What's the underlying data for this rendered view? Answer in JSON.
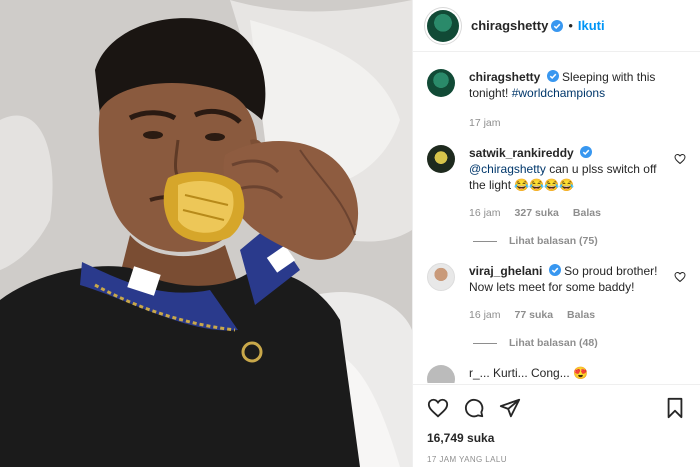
{
  "post": {
    "username": "chiragshetty",
    "follow_label": "Ikuti",
    "caption_text": "Sleeping with this tonight!",
    "caption_hashtag": "#worldchampions",
    "caption_time": "17 jam",
    "likes": "16,749 suka",
    "posted_ago": "17 JAM YANG LALU"
  },
  "comments": [
    {
      "username": "satwik_rankireddy",
      "mention": "@chiragshetty",
      "text": "can u plss switch off the light 😂😂😂😂",
      "time": "16 jam",
      "likes": "327 suka",
      "reply_label": "Balas",
      "view_replies": "Lihat balasan (75)"
    },
    {
      "username": "viraj_ghelani",
      "text": "So proud brother! Now lets meet for some baddy!",
      "time": "16 jam",
      "likes": "77 suka",
      "reply_label": "Balas",
      "view_replies": "Lihat balasan (48)"
    }
  ],
  "partial_comment": "r_... Kurti... Cong... 😍",
  "colors": {
    "link": "#0095f6",
    "verified": "#3897f0",
    "muted": "#8e8e8e",
    "mention": "#00376b"
  },
  "icons": [
    "verified-badge-icon",
    "heart-icon",
    "comment-icon",
    "share-icon",
    "bookmark-icon"
  ]
}
